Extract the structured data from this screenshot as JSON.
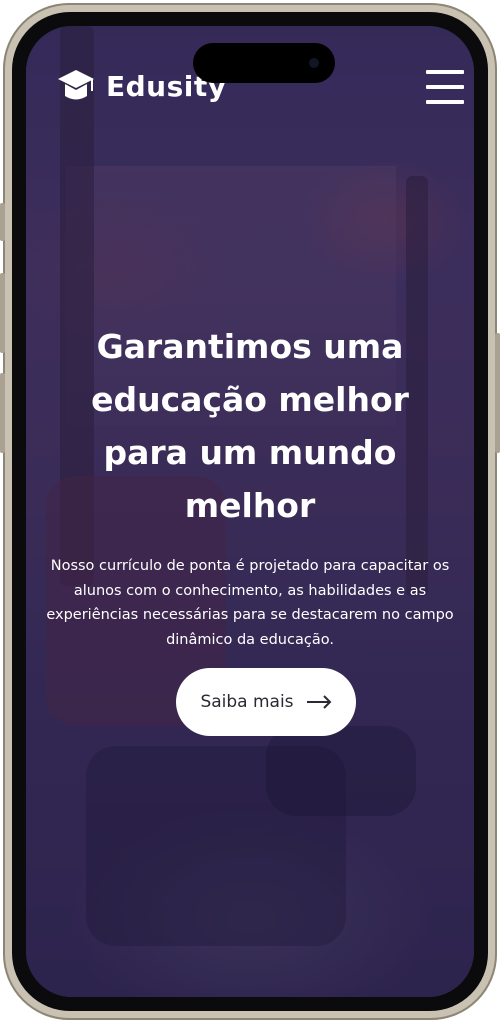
{
  "brand": {
    "name": "Edusity",
    "logo_icon": "graduation-cap-icon"
  },
  "header": {
    "menu_icon": "hamburger-menu-icon"
  },
  "hero": {
    "title": "Garantimos uma educação melhor para um mundo melhor",
    "text": "Nosso currículo de ponta é projetado para capacitar os alunos com o conhecimento, as habilidades e as experiências necessárias para se destacarem no campo dinâmico da educação.",
    "cta_label": "Saiba mais",
    "cta_icon": "arrow-right-icon"
  },
  "colors": {
    "overlay": "#2d1e5a",
    "text": "#ffffff",
    "button_bg": "#ffffff",
    "button_text": "#2a2a33",
    "frame": "#c9c2b2"
  }
}
